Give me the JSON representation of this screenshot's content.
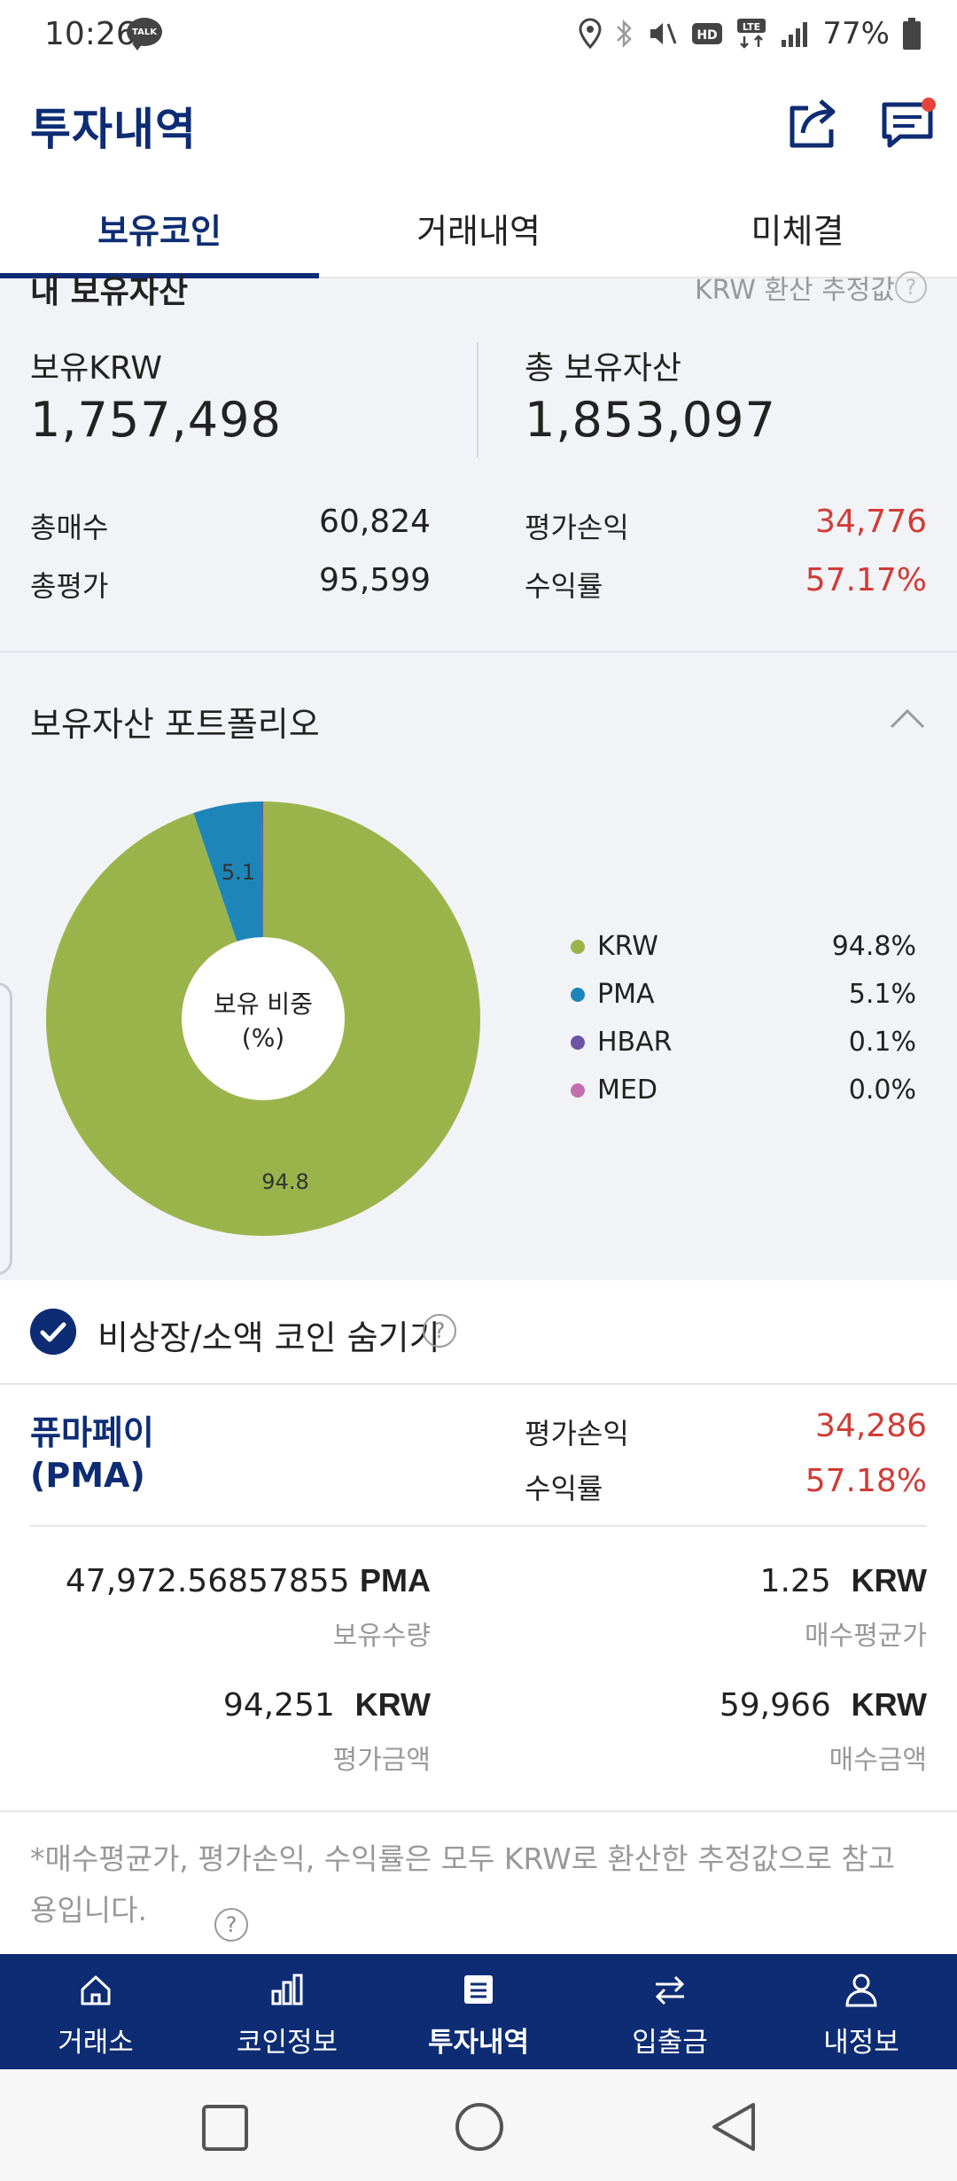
{
  "status_bar": {
    "time": "10:26",
    "talk_badge": "TALK",
    "battery": "77%",
    "icons": [
      "location-icon",
      "bluetooth-icon",
      "mute-icon",
      "hd-icon",
      "lte-icon",
      "signal-icon",
      "battery-icon"
    ]
  },
  "header": {
    "title": "투자내역",
    "share_icon": "share-icon",
    "chat_icon": "chat-icon"
  },
  "tabs": [
    {
      "label": "보유코인",
      "active": true
    },
    {
      "label": "거래내역",
      "active": false
    },
    {
      "label": "미체결",
      "active": false
    }
  ],
  "summary": {
    "section_title_cut": "내 보유자산",
    "section_note_cut": "KRW 환산 추정값",
    "held_krw_label": "보유KRW",
    "held_krw_value": "1,757,498",
    "total_assets_label": "총 보유자산",
    "total_assets_value": "1,853,097",
    "total_buy_label": "총매수",
    "total_buy_value": "60,824",
    "total_eval_label": "총평가",
    "total_eval_value": "95,599",
    "eval_pl_label": "평가손익",
    "eval_pl_value": "34,776",
    "return_label": "수익률",
    "return_value": "57.17%"
  },
  "portfolio": {
    "title": "보유자산 포트폴리오",
    "center_label_1": "보유 비중",
    "center_label_2": "(%)",
    "slice_labels": [
      "94.8",
      "5.1"
    ],
    "legend": [
      {
        "name": "KRW",
        "pct": "94.8%",
        "color": "#9ab44b"
      },
      {
        "name": "PMA",
        "pct": "5.1%",
        "color": "#1e85b8"
      },
      {
        "name": "HBAR",
        "pct": "0.1%",
        "color": "#6b54a3"
      },
      {
        "name": "MED",
        "pct": "0.0%",
        "color": "#c46fae"
      }
    ]
  },
  "chart_data": {
    "type": "pie",
    "categories": [
      "KRW",
      "PMA",
      "HBAR",
      "MED"
    ],
    "values": [
      94.8,
      5.1,
      0.1,
      0.0
    ],
    "title": "보유자산 포트폴리오",
    "colors": [
      "#9ab44b",
      "#1e85b8",
      "#6b54a3",
      "#c46fae"
    ]
  },
  "filter": {
    "hide_label": "비상장/소액 코인 숨기기",
    "checked": true
  },
  "coin": {
    "name_line1": "퓨마페이",
    "name_line2": "(PMA)",
    "eval_pl_label": "평가손익",
    "eval_pl_value": "34,286",
    "return_label": "수익률",
    "return_value": "57.18%",
    "quantity_value": "47,972.56857855",
    "quantity_unit": "PMA",
    "quantity_label": "보유수량",
    "avg_price_value": "1.25",
    "avg_price_unit": "KRW",
    "avg_price_label": "매수평균가",
    "eval_amount_value": "94,251",
    "eval_amount_unit": "KRW",
    "eval_amount_label": "평가금액",
    "buy_amount_value": "59,966",
    "buy_amount_unit": "KRW",
    "buy_amount_label": "매수금액"
  },
  "footnote": {
    "text": "*매수평균가, 평가손익, 수익률은 모두 KRW로 환산한 추정값으로 참고용입니다."
  },
  "bottom_nav": [
    {
      "label": "거래소",
      "icon": "home-icon",
      "active": false
    },
    {
      "label": "코인정보",
      "icon": "bar-chart-icon",
      "active": false
    },
    {
      "label": "투자내역",
      "icon": "document-icon",
      "active": true
    },
    {
      "label": "입출금",
      "icon": "transfer-icon",
      "active": false
    },
    {
      "label": "내정보",
      "icon": "person-icon",
      "active": false
    }
  ]
}
